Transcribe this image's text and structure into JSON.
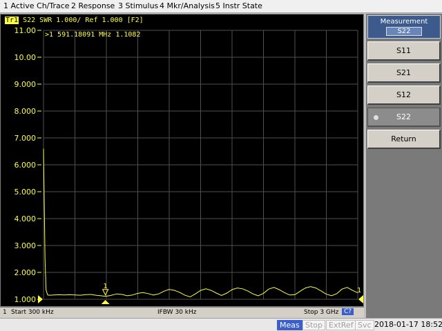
{
  "menu": [
    {
      "label": "1 Active Ch/Trace"
    },
    {
      "label": "2 Response"
    },
    {
      "label": "3 Stimulus"
    },
    {
      "label": "4 Mkr/Analysis"
    },
    {
      "label": "5 Instr State"
    }
  ],
  "trace": {
    "badge": "Tr1",
    "header": "S22  SWR 1.000/ Ref 1.000  [F2]",
    "color": "#ffff40"
  },
  "marker": {
    "readout": ">1  591.18091 MHz  1.1082",
    "label": "1",
    "end_label": "1"
  },
  "status": {
    "channel": "1",
    "start": "Start 300 kHz",
    "ifbw": "IFBW 30 kHz",
    "stop": "Stop 3 GHz",
    "cal": "C?"
  },
  "softkeys": {
    "title": "Measurement",
    "current": "S22",
    "items": [
      {
        "label": "S11",
        "selected": false
      },
      {
        "label": "S21",
        "selected": false
      },
      {
        "label": "S12",
        "selected": false
      },
      {
        "label": "S22",
        "selected": true
      },
      {
        "label": "Return",
        "selected": false
      }
    ]
  },
  "sysbar": {
    "indicators": [
      {
        "label": "Meas",
        "active": true
      },
      {
        "label": "Stop",
        "active": false
      },
      {
        "label": "ExtRef",
        "active": false
      },
      {
        "label": "Svc",
        "active": false
      }
    ],
    "datetime": "2018-01-17 18:52"
  },
  "chart_data": {
    "type": "line",
    "y_tick_labels": [
      "11.00",
      "10.00",
      "9.000",
      "8.000",
      "7.000",
      "6.000",
      "5.000",
      "4.000",
      "3.000",
      "2.000",
      "1.000"
    ],
    "ylim": [
      1,
      11
    ],
    "xlim_mhz": [
      0.3,
      3000
    ],
    "x_divisions": 10,
    "grid": true,
    "series": [
      {
        "trace_color": "#ffff40",
        "x_mhz": [
          0.3,
          5,
          15,
          25,
          40,
          60,
          100,
          150,
          200,
          250,
          300,
          350,
          400,
          450,
          500,
          550,
          591.18,
          640,
          700,
          750,
          800,
          850,
          900,
          950,
          1000,
          1050,
          1100,
          1150,
          1200,
          1250,
          1300,
          1350,
          1400,
          1450,
          1500,
          1550,
          1600,
          1650,
          1700,
          1750,
          1800,
          1850,
          1900,
          1950,
          2000,
          2050,
          2100,
          2150,
          2200,
          2250,
          2300,
          2350,
          2400,
          2450,
          2500,
          2550,
          2600,
          2650,
          2700,
          2750,
          2800,
          2850,
          2900,
          2950,
          3000
        ],
        "y": [
          6.6,
          5.3,
          2.5,
          1.35,
          1.16,
          1.15,
          1.16,
          1.17,
          1.16,
          1.17,
          1.16,
          1.15,
          1.17,
          1.18,
          1.15,
          1.13,
          1.108,
          1.14,
          1.2,
          1.18,
          1.13,
          1.16,
          1.22,
          1.25,
          1.21,
          1.16,
          1.2,
          1.3,
          1.37,
          1.33,
          1.26,
          1.15,
          1.09,
          1.2,
          1.33,
          1.39,
          1.33,
          1.23,
          1.14,
          1.23,
          1.36,
          1.42,
          1.39,
          1.31,
          1.2,
          1.13,
          1.22,
          1.38,
          1.44,
          1.36,
          1.25,
          1.16,
          1.17,
          1.3,
          1.42,
          1.47,
          1.42,
          1.31,
          1.19,
          1.13,
          1.21,
          1.38,
          1.44,
          1.33,
          1.24
        ]
      }
    ]
  }
}
